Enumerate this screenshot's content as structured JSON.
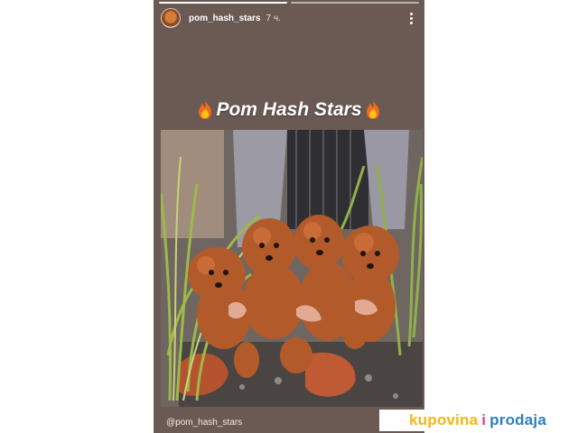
{
  "story": {
    "username": "pom_hash_stars",
    "time": "7 ч.",
    "title": "Pom Hash Stars",
    "caption": "@pom_hash_stars"
  },
  "watermark": {
    "word1": "kupovina",
    "word2": "i",
    "word3": "prodaja"
  },
  "icons": [
    "avatar",
    "more-options-icon",
    "fire-emoji-icon"
  ],
  "colors": {
    "story_background": "#6b5a53",
    "watermark_yellow": "#f2b713",
    "watermark_pink": "#e83e8c",
    "watermark_blue": "#2b7fc1"
  }
}
